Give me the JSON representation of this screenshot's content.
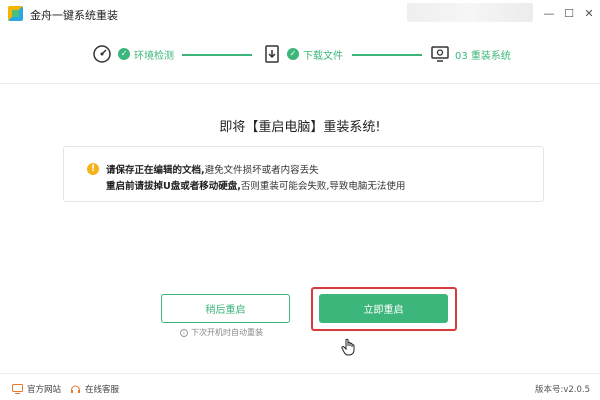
{
  "window": {
    "title": "金舟一键系统重装",
    "minimize_glyph": "—",
    "maximize_glyph": "☐",
    "close_glyph": "✕"
  },
  "steps": [
    {
      "label": "环境检测",
      "icon": "speedometer-icon",
      "status": "done"
    },
    {
      "label": "下载文件",
      "icon": "download-file-icon",
      "status": "done"
    },
    {
      "label": "03 重装系统",
      "icon": "monitor-gear-icon",
      "status": "current"
    }
  ],
  "main": {
    "title": "即将【重启电脑】重装系统!",
    "notice": {
      "line1_bold": "请保存正在编辑的文档,",
      "line1_rest": "避免文件损坏或者内容丢失",
      "line2_bold": "重启前请拔掉U盘或者移动硬盘,",
      "line2_rest": "否则重装可能会失败,导致电脑无法使用"
    },
    "later_button": "稍后重启",
    "later_hint": "下次开机时自动重装",
    "now_button": "立即重启"
  },
  "footer": {
    "website": "官方网站",
    "support": "在线客服",
    "version": "版本号:v2.0.5"
  },
  "colors": {
    "accent": "#3cb67a",
    "warning": "#f6b319",
    "highlight": "#d83b3b"
  }
}
